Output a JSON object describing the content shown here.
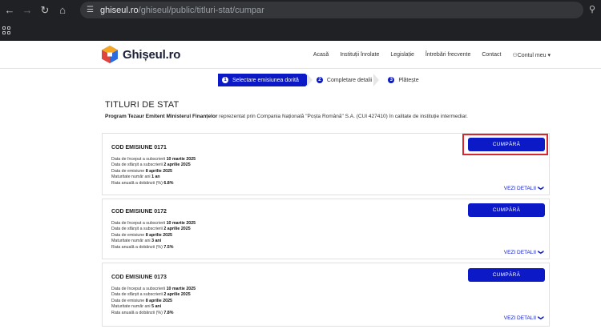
{
  "browser": {
    "url_host": "ghiseul.ro",
    "url_path": "/ghiseul/public/titluri-stat/cumpar"
  },
  "header": {
    "logo_text": "Ghișeul.ro",
    "nav": [
      "Acasă",
      "Instituții înrolate",
      "Legislație",
      "Întrebări frecvente",
      "Contact",
      "⚇Contul meu ▾"
    ]
  },
  "steps": [
    {
      "num": "1",
      "label": "Selectare emisiunea dorită"
    },
    {
      "num": "2",
      "label": "Completare detalii"
    },
    {
      "num": "3",
      "label": "Plătește"
    }
  ],
  "page": {
    "title": "TITLURI DE STAT",
    "intro_bold": "Program Tezaur Emitent Ministerul Finanțelor",
    "intro_rest": " reprezentat prin Compania Națională \"Poșta Română\" S.A. (CUI 427410) în calitate de instituție intermediar."
  },
  "labels": {
    "start": "Data de început a subscrierii ",
    "end": "Data de sfârșit a subscrierii ",
    "issue": "Data de emisiune ",
    "maturity": "Maturitate număr ani ",
    "rate": "Rata anuală a dobânzii (%) ",
    "buy": "CUMPĂRĂ",
    "details": "VEZI DETALII"
  },
  "emissions": [
    {
      "title": "COD EMISIUNE 0171",
      "start": "10 martie 2025",
      "end": "2 aprilie 2025",
      "issue": "8 aprilie 2025",
      "maturity": "1 an",
      "rate": "6.8%"
    },
    {
      "title": "COD EMISIUNE 0172",
      "start": "10 martie 2025",
      "end": "2 aprilie 2025",
      "issue": "8 aprilie 2025",
      "maturity": "3 ani",
      "rate": "7.5%"
    },
    {
      "title": "COD EMISIUNE 0173",
      "start": "10 martie 2025",
      "end": "2 aprilie 2025",
      "issue": "8 aprilie 2025",
      "maturity": "5 ani",
      "rate": "7.8%"
    }
  ],
  "colors": {
    "primary": "#0b1ac6",
    "highlight": "#d8282f"
  }
}
